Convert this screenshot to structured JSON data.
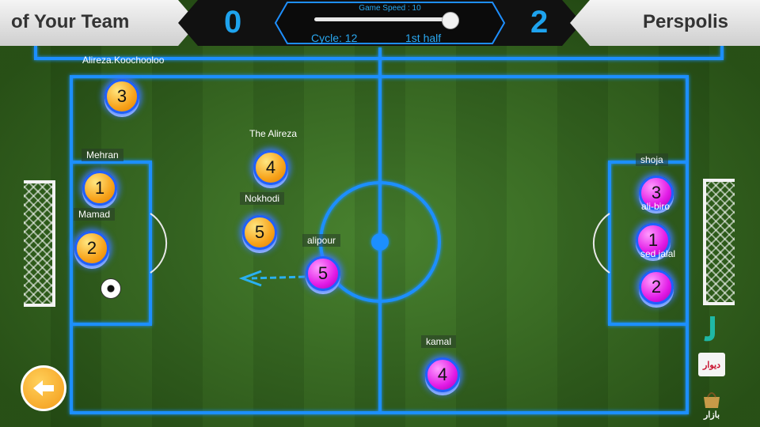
{
  "hud": {
    "left_team": "of Your Team",
    "right_team": "Perspolis",
    "left_score": "0",
    "right_score": "2",
    "speed_label": "Game Speed : 10",
    "speed_value": 10,
    "cycle": "Cycle: 12",
    "half": "1st half"
  },
  "yellow_team": [
    {
      "number": "3",
      "name": "Alireza.Koochooloo"
    },
    {
      "number": "1",
      "name": "Mehran"
    },
    {
      "number": "2",
      "name": "Mamad"
    },
    {
      "number": "4",
      "name": "The Alireza"
    },
    {
      "number": "5",
      "name": "Nokhodi"
    }
  ],
  "purple_team": [
    {
      "number": "5",
      "name": "alipour"
    },
    {
      "number": "4",
      "name": "kamal"
    },
    {
      "number": "3",
      "name": "shoja"
    },
    {
      "number": "1",
      "name": "ali-biro"
    },
    {
      "number": "2",
      "name": "sed jalal"
    }
  ],
  "side_icons": [
    "jadoo-icon",
    "divar-icon",
    "bazaar-bag-icon"
  ],
  "side_icon_texts": {
    "divar": "دیوار",
    "bazaar": "بازار"
  },
  "colors": {
    "line": "#1e8fff",
    "yellow_player": "#f7a21a",
    "purple_player": "#e21be6",
    "score": "#1ea3ee"
  },
  "back_button": "back-arrow-icon"
}
